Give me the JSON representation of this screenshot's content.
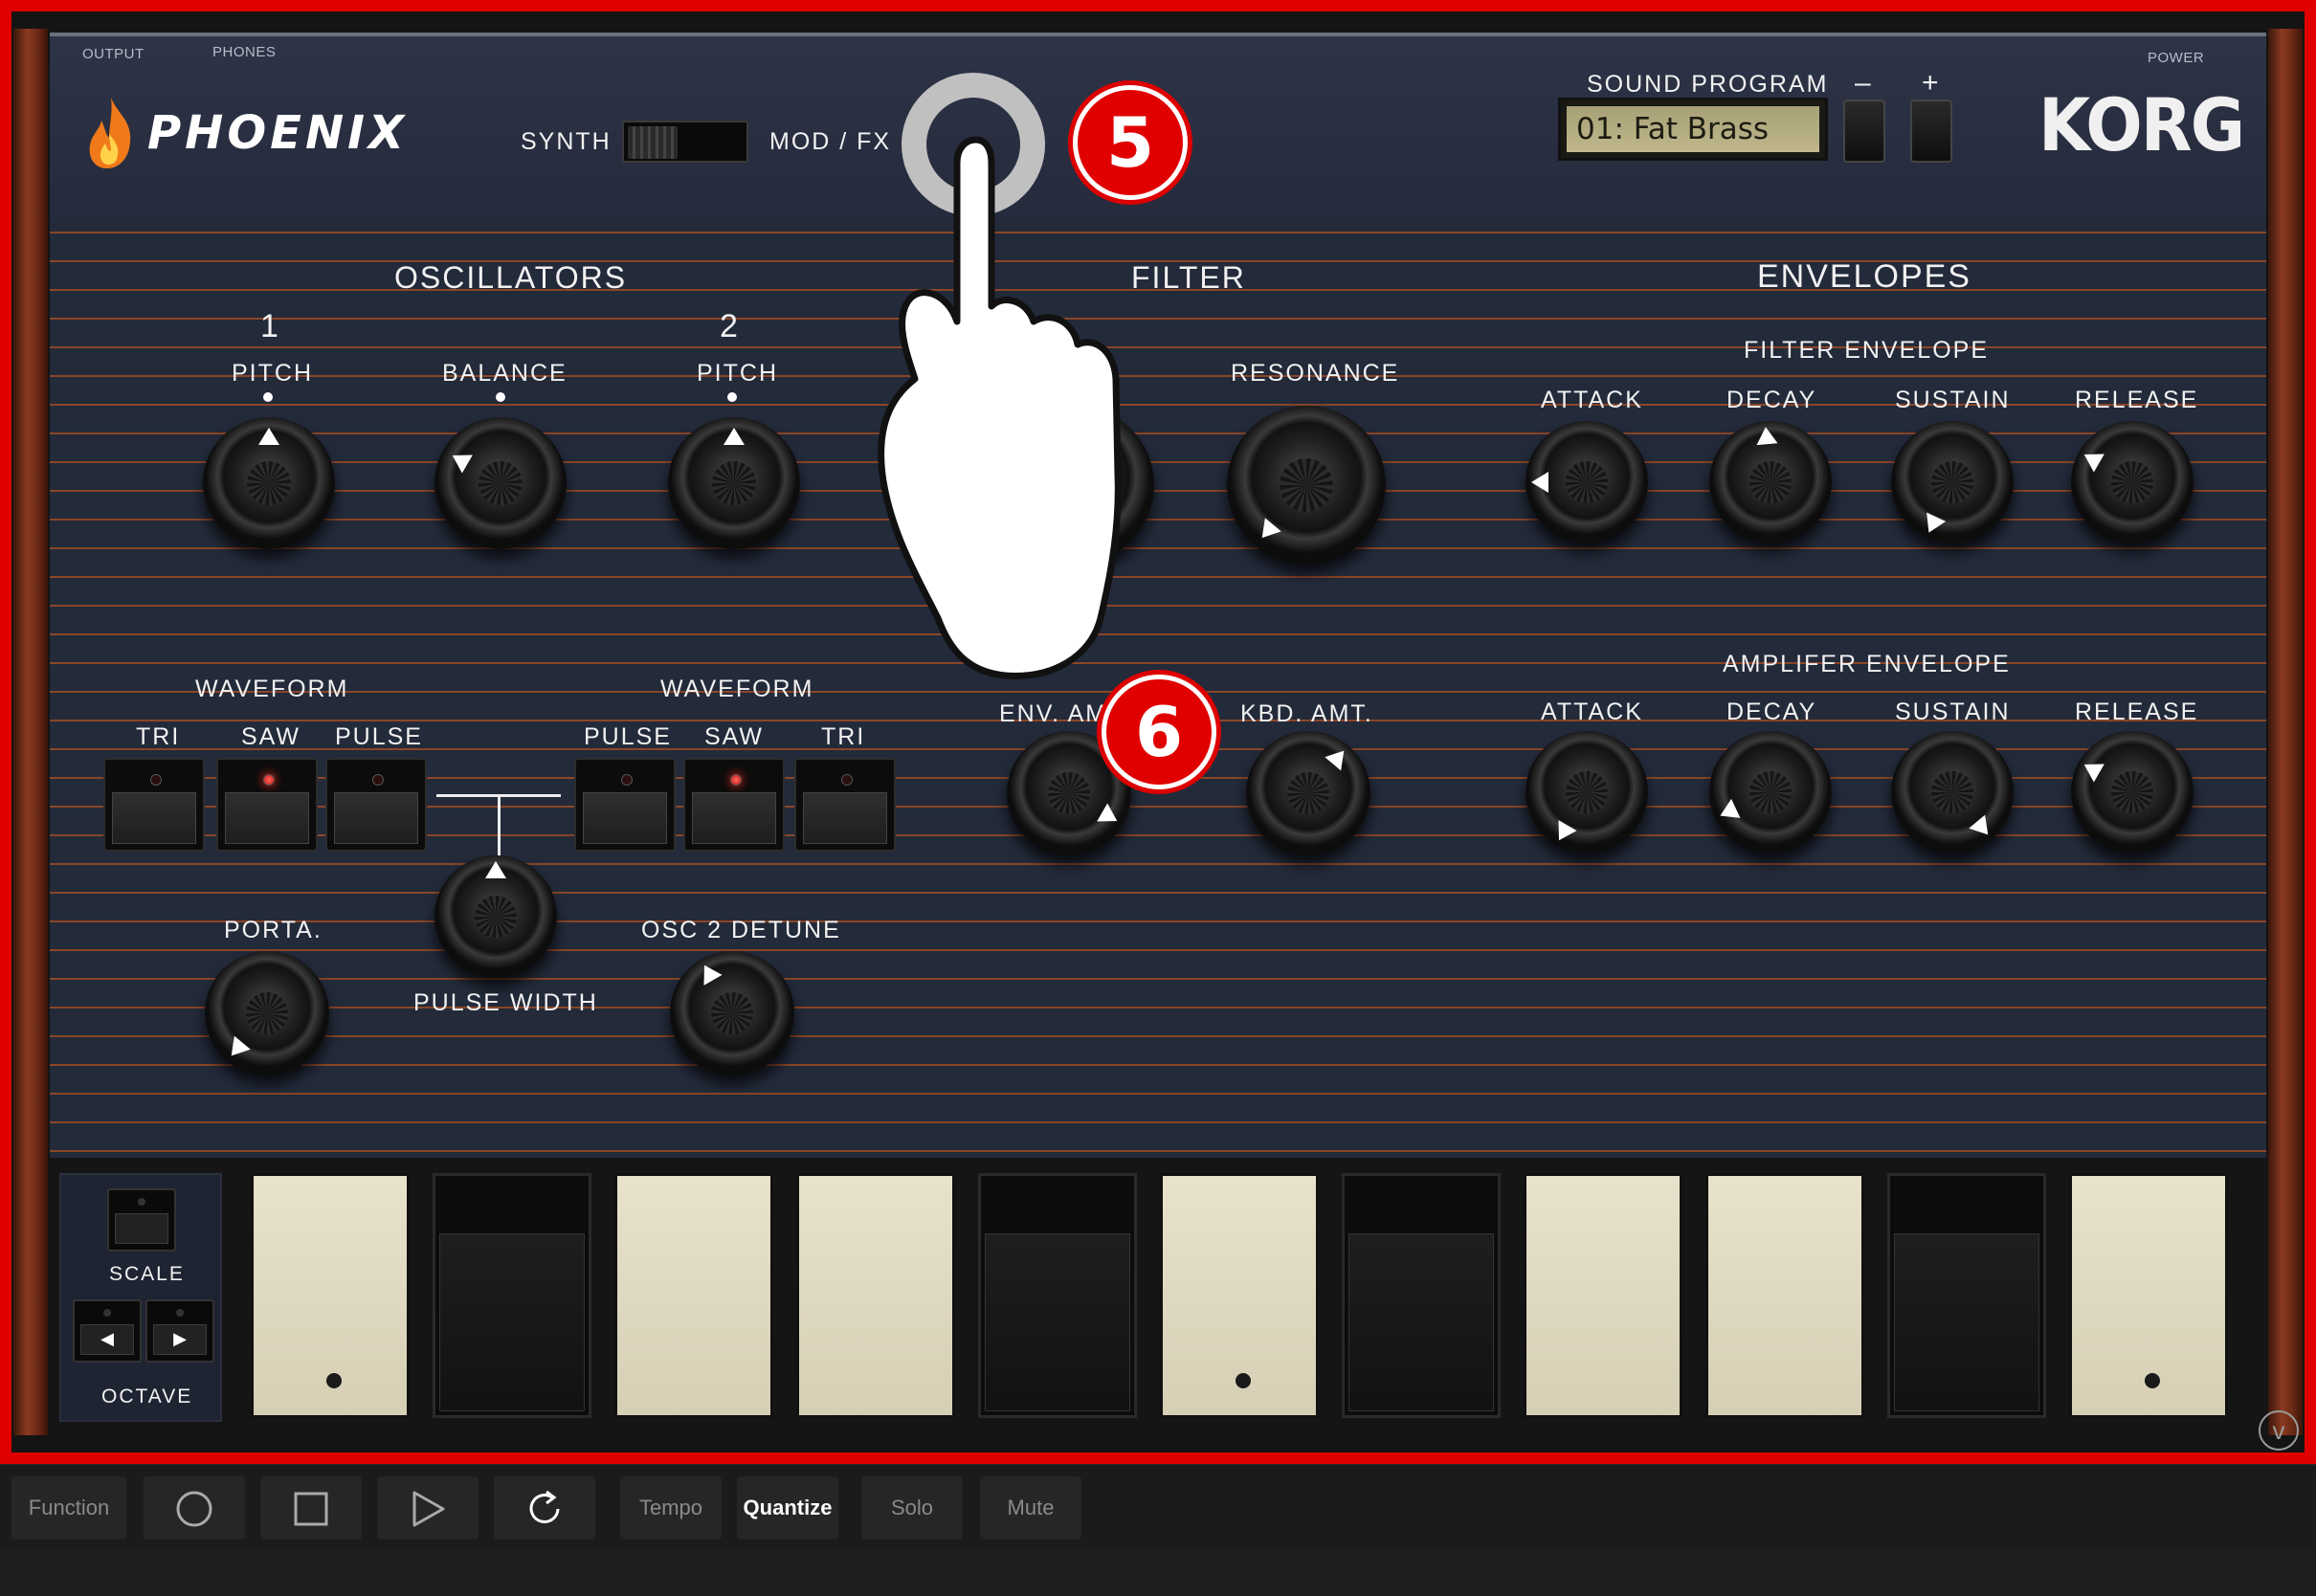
{
  "header": {
    "output_label": "OUTPUT",
    "phones_label": "PHONES",
    "power_label": "POWER",
    "app_name": "PHOENIX",
    "synth_label": "SYNTH",
    "modfx_label": "MOD / FX",
    "sound_program_label": "SOUND PROGRAM",
    "program_value": "01: Fat Brass",
    "minus_label": "–",
    "plus_label": "+",
    "brand": "KORG"
  },
  "oscillators": {
    "title": "OSCILLATORS",
    "osc1": "1",
    "osc2": "2",
    "pitch1": "PITCH",
    "balance": "BALANCE",
    "pitch2": "PITCH",
    "waveform1": "WAVEFORM",
    "waveform2": "WAVEFORM",
    "tri1": "TRI",
    "saw1": "SAW",
    "pulse1": "PULSE",
    "pulse2": "PULSE",
    "saw2": "SAW",
    "tri2": "TRI",
    "porta": "PORTA.",
    "pulse_width": "PULSE WIDTH",
    "osc2_detune": "OSC 2 DETUNE"
  },
  "filter": {
    "title": "FILTER",
    "resonance": "RESONANCE",
    "env_amt": "ENV. AMT.",
    "kbd_amt": "KBD. AMT."
  },
  "envelopes": {
    "title": "ENVELOPES",
    "filter_env": "FILTER ENVELOPE",
    "amp_env": "AMPLIFER ENVELOPE",
    "attack": "ATTACK",
    "decay": "DECAY",
    "sustain": "SUSTAIN",
    "release": "RELEASE"
  },
  "keyboard": {
    "scale": "SCALE",
    "octave": "OCTAVE",
    "left_arrow": "◀",
    "right_arrow": "▶"
  },
  "transport": {
    "function": "Function",
    "tempo": "Tempo",
    "quantize": "Quantize",
    "solo": "Solo",
    "mute": "Mute"
  },
  "annotations": {
    "step5": "5",
    "step6": "6"
  },
  "colors": {
    "panel": "#232a3a",
    "stripe": "#8a4528",
    "led_on": "#e01010",
    "highlight": "#e00000"
  }
}
